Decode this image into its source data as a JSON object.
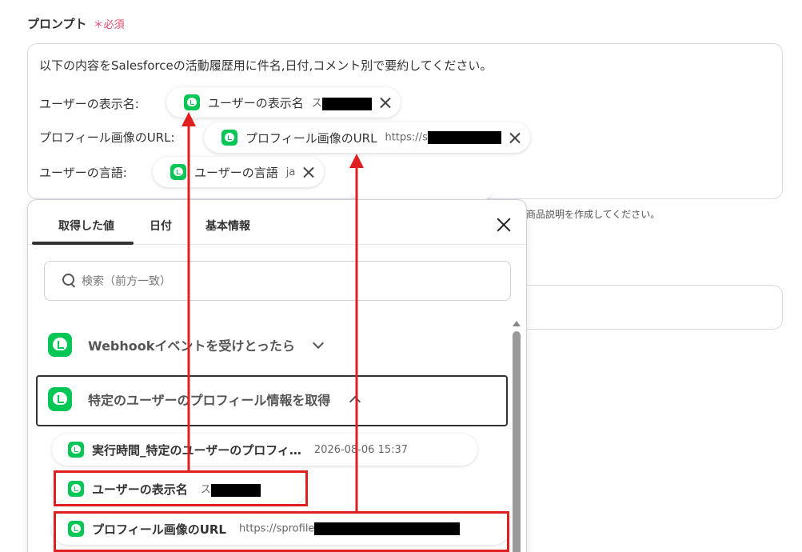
{
  "field": {
    "label": "プロンプト",
    "required": "＊必須"
  },
  "prompt": {
    "intro": "以下の内容をSalesforceの活動履歴用に件名,日付,コメント別で要約してください。",
    "rows": [
      {
        "label": "ユーザーの表示名:",
        "chip_label": "ユーザーの表示名",
        "chip_value": "ス"
      },
      {
        "label": "プロフィール画像のURL:",
        "chip_label": "プロフィール画像のURL",
        "chip_value": "https://s"
      },
      {
        "label": "ユーザーの言語:",
        "chip_label": "ユーザーの言語",
        "chip_value": "ja"
      }
    ]
  },
  "helper_text": "商品説明を作成してください。",
  "panel": {
    "tabs": [
      "取得した値",
      "日付",
      "基本情報"
    ],
    "search_placeholder": "検索（前方一致）",
    "groups": [
      {
        "title": "Webhookイベントを受けとったら",
        "expanded": false
      },
      {
        "title": "特定のユーザーのプロフィール情報を取得",
        "expanded": true
      }
    ],
    "items": [
      {
        "label": "実行時間_特定のユーザーのプロフィ…",
        "value": "2026-08-06 15:37"
      },
      {
        "label": "ユーザーの表示名",
        "value": "ス"
      },
      {
        "label": "プロフィール画像のURL",
        "value": "https://sprofile"
      }
    ]
  },
  "colors": {
    "line_green": "#06c755",
    "highlight_red": "#e02020",
    "required_pink": "#e5486e"
  },
  "icons": [
    "line-app-icon",
    "close-icon",
    "search-icon",
    "chevron-down-icon",
    "chevron-up-icon"
  ]
}
